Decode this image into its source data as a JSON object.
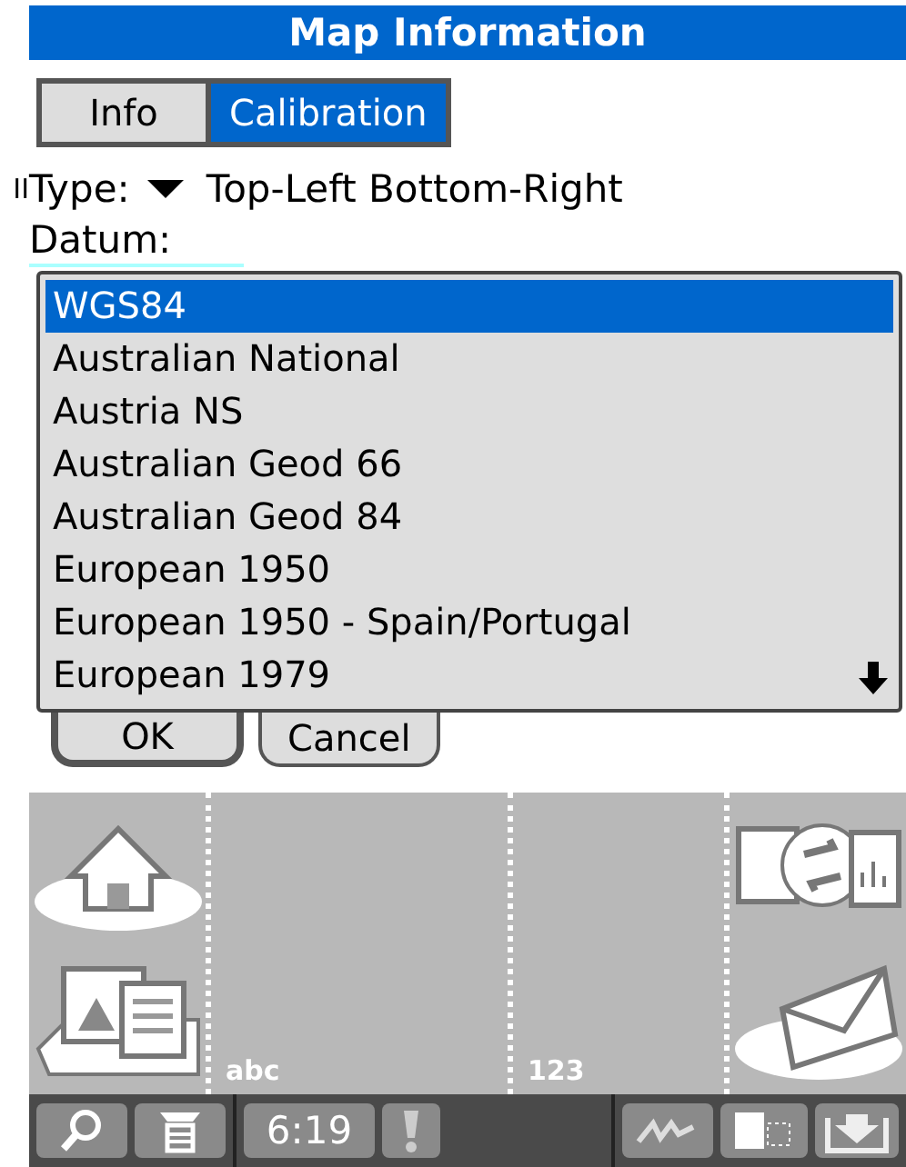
{
  "window": {
    "title": "Map Information"
  },
  "tabs": [
    {
      "label": "Info",
      "selected": false
    },
    {
      "label": "Calibration",
      "selected": true
    }
  ],
  "clipped_text": "II",
  "type_field": {
    "label": "Type:",
    "value": "Top-Left Bottom-Right"
  },
  "datum": {
    "label": "Datum:"
  },
  "datum_list": {
    "more_below": true,
    "items": [
      {
        "label": "WGS84",
        "selected": true
      },
      {
        "label": "Australian National",
        "selected": false
      },
      {
        "label": "Austria NS",
        "selected": false
      },
      {
        "label": "Australian Geod 66",
        "selected": false
      },
      {
        "label": "Australian Geod 84",
        "selected": false
      },
      {
        "label": "European 1950",
        "selected": false
      },
      {
        "label": "European 1950 - Spain/Portugal",
        "selected": false
      },
      {
        "label": "European 1979",
        "selected": false
      }
    ]
  },
  "buttons": [
    {
      "label": "OK",
      "default": true
    },
    {
      "label": "Cancel",
      "default": false
    }
  ],
  "graffiti": {
    "letters_label": "abc",
    "numbers_label": "123"
  },
  "status_bar": {
    "time": "6:19"
  }
}
